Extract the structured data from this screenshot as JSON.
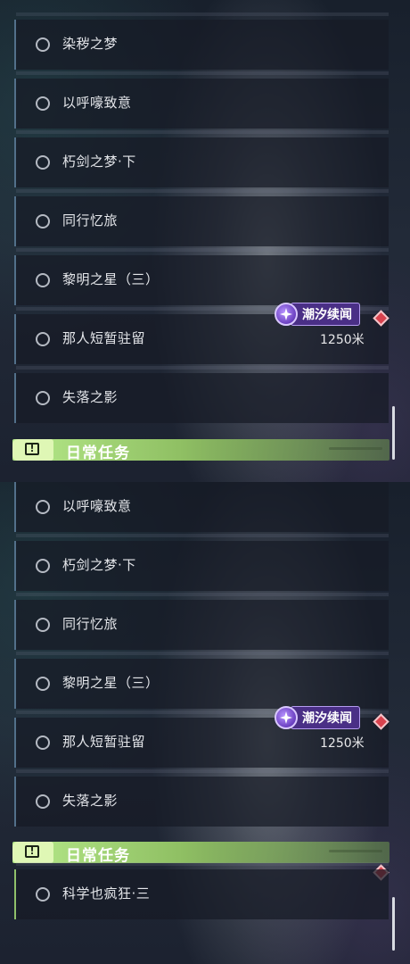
{
  "panel_a": {
    "quests": [
      {
        "title": "染秽之梦"
      },
      {
        "title": "以呼嚎致意"
      },
      {
        "title": "朽剑之梦·下"
      },
      {
        "title": "同行忆旅"
      },
      {
        "title": "黎明之星（三）"
      },
      {
        "title": "那人短暂驻留",
        "tag": "潮汐续闻",
        "distance": "1250米"
      },
      {
        "title": "失落之影"
      }
    ],
    "section": {
      "title": "日常任务",
      "icon": "exclamation-box-icon"
    }
  },
  "panel_b": {
    "quests": [
      {
        "title": "以呼嚎致意"
      },
      {
        "title": "朽剑之梦·下"
      },
      {
        "title": "同行忆旅"
      },
      {
        "title": "黎明之星（三）"
      },
      {
        "title": "那人短暂驻留",
        "tag": "潮汐续闻",
        "distance": "1250米"
      },
      {
        "title": "失落之影"
      }
    ],
    "section": {
      "title": "日常任务",
      "icon": "exclamation-box-icon"
    },
    "daily_quests": [
      {
        "title": "科学也疯狂·三"
      }
    ]
  },
  "colors": {
    "accent_green": "#b6ea8a",
    "tag_purple": "#4a2f86",
    "marker_red": "#d9424e",
    "row_border": "#52708a"
  }
}
